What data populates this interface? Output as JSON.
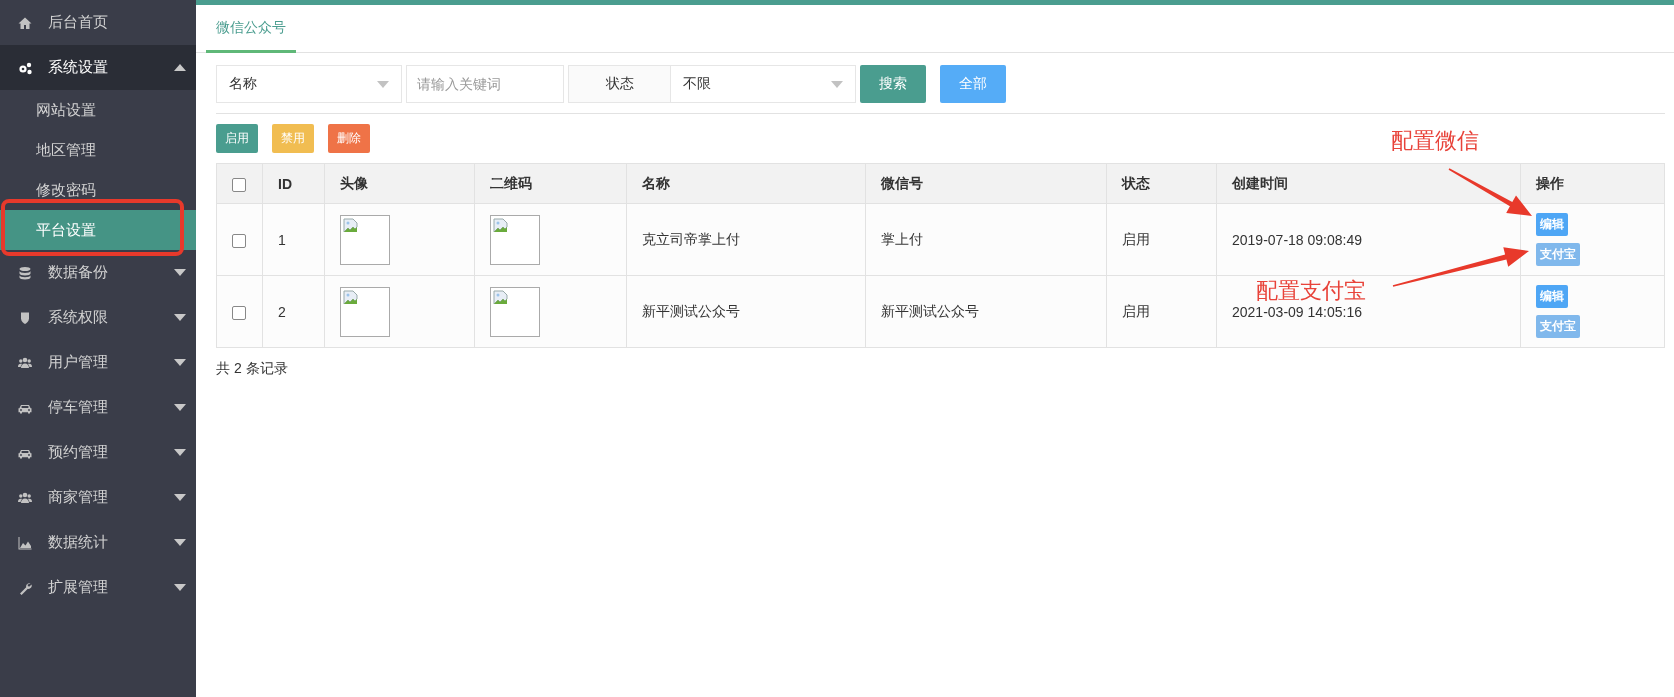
{
  "sidebar": {
    "items": [
      {
        "kind": "link",
        "label": "后台首页",
        "selected": false
      },
      {
        "kind": "group",
        "label": "系统设置",
        "selected": false,
        "expanded": true,
        "children": [
          {
            "label": "网站设置",
            "selected": false
          },
          {
            "label": "地区管理",
            "selected": false
          },
          {
            "label": "修改密码",
            "selected": false
          },
          {
            "label": "平台设置",
            "selected": true
          }
        ]
      },
      {
        "kind": "group",
        "label": "数据备份",
        "selected": false,
        "expanded": false
      },
      {
        "kind": "group",
        "label": "系统权限",
        "selected": false,
        "expanded": false
      },
      {
        "kind": "group",
        "label": "用户管理",
        "selected": false,
        "expanded": false
      },
      {
        "kind": "group",
        "label": "停车管理",
        "selected": false,
        "expanded": false
      },
      {
        "kind": "group",
        "label": "预约管理",
        "selected": false,
        "expanded": false
      },
      {
        "kind": "group",
        "label": "商家管理",
        "selected": false,
        "expanded": false
      },
      {
        "kind": "group",
        "label": "数据统计",
        "selected": false,
        "expanded": false
      },
      {
        "kind": "group",
        "label": "扩展管理",
        "selected": false,
        "expanded": false
      }
    ]
  },
  "tabs": [
    {
      "label": "微信公众号",
      "selected": true
    }
  ],
  "filters": {
    "field_select": {
      "value": "名称"
    },
    "keyword": {
      "placeholder": "请输入关键词"
    },
    "status_label": "状态",
    "status_select": {
      "value": "不限"
    },
    "buttons": [
      {
        "kind": "search",
        "label": "搜索"
      },
      {
        "kind": "all",
        "label": "全部"
      }
    ]
  },
  "bulk_actions": [
    {
      "label": "启用",
      "color": "#4a9d8f"
    },
    {
      "label": "禁用",
      "color": "#f1bd51"
    },
    {
      "label": "删除",
      "color": "#ef7347"
    }
  ],
  "table": {
    "select_all": {
      "checked": false
    },
    "columns": [
      "ID",
      "头像",
      "二维码",
      "名称",
      "微信号",
      "状态",
      "创建时间",
      "操作"
    ],
    "rows": [
      {
        "checked": false,
        "id": "1",
        "name": "克立司帝掌上付",
        "wechat_id": "掌上付",
        "status": "启用",
        "created": "2019-07-18 09:08:49",
        "actions": [
          {
            "kind": "edit",
            "label": "编辑"
          },
          {
            "kind": "alipay",
            "label": "支付宝"
          }
        ]
      },
      {
        "checked": false,
        "id": "2",
        "name": "新平测试公众号",
        "wechat_id": "新平测试公众号",
        "status": "启用",
        "created": "2021-03-09 14:05:16",
        "actions": [
          {
            "kind": "edit",
            "label": "编辑"
          },
          {
            "kind": "alipay",
            "label": "支付宝"
          }
        ]
      }
    ]
  },
  "record_count": "共 2 条记录",
  "annotations": [
    {
      "kind": "highlight"
    },
    {
      "kind": "arrow-label",
      "text": "配置微信"
    },
    {
      "kind": "arrow-label",
      "text": "配置支付宝"
    }
  ]
}
